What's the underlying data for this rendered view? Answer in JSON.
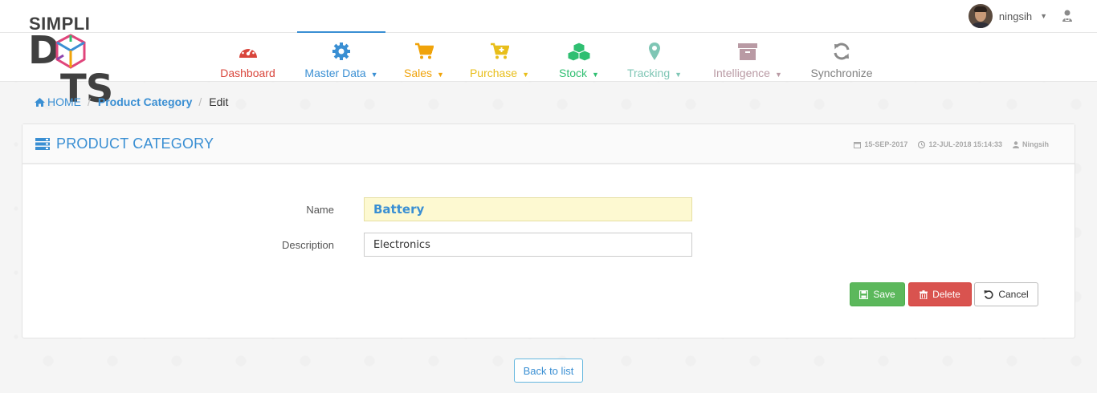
{
  "brand": {
    "line1": "SIMPLI",
    "line2_left": "D",
    "line2_right": "TS"
  },
  "user": {
    "name": "ningsih"
  },
  "nav": [
    {
      "label": "Dashboard",
      "color": "#d9453b",
      "caret": false,
      "active": false,
      "icon": "speedometer-icon"
    },
    {
      "label": "Master Data",
      "color": "#3a8fd3",
      "caret": true,
      "active": true,
      "icon": "gear-icon"
    },
    {
      "label": "Sales",
      "color": "#f0a30a",
      "caret": true,
      "active": false,
      "icon": "cart-icon"
    },
    {
      "label": "Purchase",
      "color": "#e8be1a",
      "caret": true,
      "active": false,
      "icon": "cart-plus-icon"
    },
    {
      "label": "Stock",
      "color": "#2fbf71",
      "caret": true,
      "active": false,
      "icon": "cubes-icon"
    },
    {
      "label": "Tracking",
      "color": "#7fc6b5",
      "caret": true,
      "active": false,
      "icon": "map-marker-icon"
    },
    {
      "label": "Intelligence",
      "color": "#b99aa4",
      "caret": true,
      "active": false,
      "icon": "archive-icon"
    },
    {
      "label": "Synchronize",
      "color": "#808080",
      "caret": false,
      "active": false,
      "icon": "refresh-icon"
    }
  ],
  "breadcrumb": {
    "home": "HOME",
    "section": "Product Category",
    "current": "Edit"
  },
  "panel": {
    "title": "PRODUCT CATEGORY",
    "created": "15-SEP-2017",
    "modified": "12-JUL-2018 15:14:33",
    "author": "Ningsih"
  },
  "form": {
    "name_label": "Name",
    "name_value": "Battery",
    "description_label": "Description",
    "description_value": "Electronics"
  },
  "buttons": {
    "save": "Save",
    "delete": "Delete",
    "cancel": "Cancel",
    "back": "Back to list"
  },
  "colors": {
    "accent": "#3a8fd3",
    "save": "#5cb85c",
    "delete": "#d9534f"
  }
}
